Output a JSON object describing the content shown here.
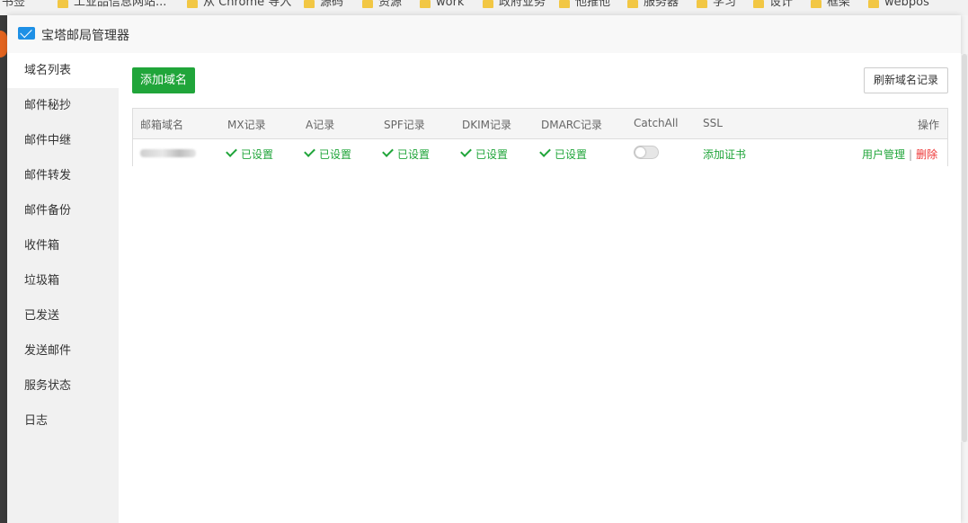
{
  "bookmarks": [
    {
      "label": "书签"
    },
    {
      "label": "工业品信息网站..."
    },
    {
      "label": "从 Chrome 导入"
    },
    {
      "label": "源码"
    },
    {
      "label": "资源"
    },
    {
      "label": "work"
    },
    {
      "label": "政府业务"
    },
    {
      "label": "他推他"
    },
    {
      "label": "服务器"
    },
    {
      "label": "学习"
    },
    {
      "label": "设计"
    },
    {
      "label": "框架"
    },
    {
      "label": "webpos"
    }
  ],
  "window": {
    "title": "宝塔邮局管理器"
  },
  "sidebar": {
    "items": [
      {
        "label": "域名列表",
        "active": true
      },
      {
        "label": "邮件秘抄"
      },
      {
        "label": "邮件中继"
      },
      {
        "label": "邮件转发"
      },
      {
        "label": "邮件备份"
      },
      {
        "label": "收件箱"
      },
      {
        "label": "垃圾箱"
      },
      {
        "label": "已发送"
      },
      {
        "label": "发送邮件"
      },
      {
        "label": "服务状态"
      },
      {
        "label": "日志"
      }
    ]
  },
  "toolbar": {
    "add_domain_label": "添加域名",
    "refresh_label": "刷新域名记录"
  },
  "table": {
    "columns": [
      "邮箱域名",
      "MX记录",
      "A记录",
      "SPF记录",
      "DKIM记录",
      "DMARC记录",
      "CatchAll",
      "SSL",
      "操作"
    ],
    "rows": [
      {
        "mx": "已设置",
        "a": "已设置",
        "spf": "已设置",
        "dkim": "已设置",
        "dmarc": "已设置",
        "catchall": false,
        "ssl": "添加证书",
        "action_users": "用户管理",
        "action_sep": "|",
        "action_delete": "删除"
      }
    ]
  },
  "colors": {
    "primary_green": "#20a53a",
    "danger_red": "#e33333",
    "title_icon_blue": "#1e90e6"
  }
}
